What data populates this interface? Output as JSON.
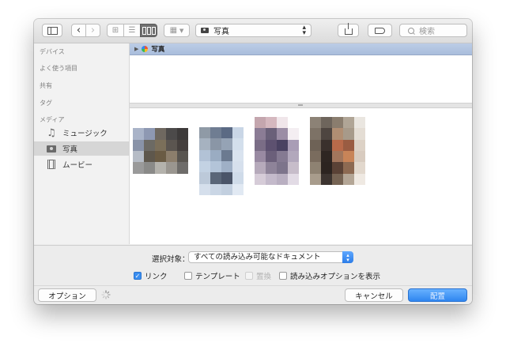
{
  "toolbar": {
    "location": "写真",
    "search_placeholder": "検索"
  },
  "sidebar": {
    "sections": {
      "devices": "デバイス",
      "favorites": "よく使う項目",
      "shared": "共有",
      "tags": "タグ",
      "media": "メディア"
    },
    "media_items": [
      {
        "label": "ミュージック",
        "icon": "music-note-icon"
      },
      {
        "label": "写真",
        "icon": "camera-icon",
        "selected": true
      },
      {
        "label": "ムービー",
        "icon": "film-icon"
      }
    ]
  },
  "pathbar": {
    "label": "写真"
  },
  "bottom": {
    "format_label": "選択対象：",
    "format_value": "すべての読み込み可能なドキュメント",
    "checkboxes": [
      {
        "label": "リンク",
        "checked": true,
        "enabled": true
      },
      {
        "label": "テンプレート",
        "checked": false,
        "enabled": true
      },
      {
        "label": "置換",
        "checked": false,
        "enabled": false
      },
      {
        "label": "読み込みオプションを表示",
        "checked": false,
        "enabled": true
      }
    ],
    "options_button": "オプション",
    "cancel_button": "キャンセル",
    "place_button": "配置"
  },
  "colors": {
    "accent": "#2f86f0",
    "pathbar": "#b3c5e2",
    "sidebar_selected": "#d6d6d6"
  }
}
